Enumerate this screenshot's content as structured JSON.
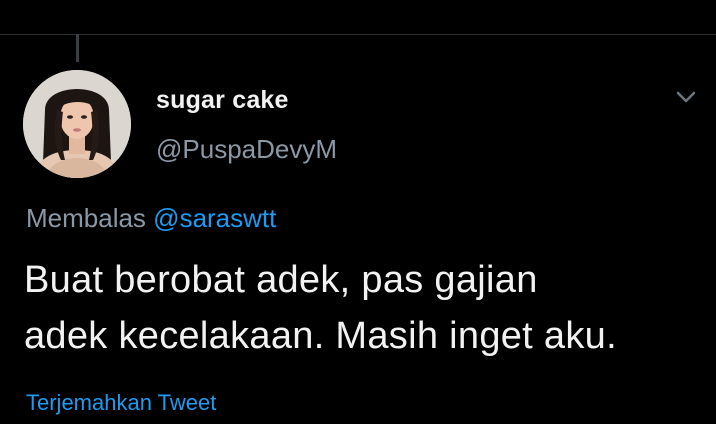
{
  "colors": {
    "background": "#000000",
    "text_primary": "#f2f2f2",
    "text_secondary": "#8b98a5",
    "link": "#1d9bf0",
    "divider": "#2f3336"
  },
  "tweet": {
    "author": {
      "display_name": "sugar cake",
      "handle": "@PuspaDevyM",
      "avatar_icon": "profile-photo"
    },
    "menu_icon": "chevron-down-icon",
    "reply_context": {
      "prefix": "Membalas",
      "mention": "@saraswtt"
    },
    "text_lines": [
      "Buat berobat adek, pas gajian",
      "adek kecelakaan. Masih inget aku."
    ],
    "translate_label": "Terjemahkan Tweet"
  }
}
